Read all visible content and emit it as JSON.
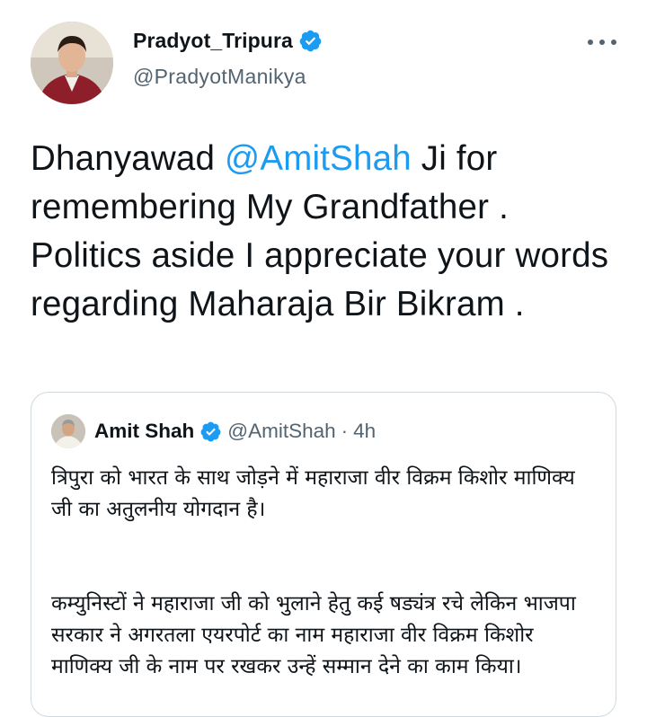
{
  "author": {
    "name": "Pradyot_Tripura",
    "handle": "@PradyotManikya",
    "verified": true
  },
  "tweet": {
    "text_part1": "Dhanyawad ",
    "mention": "@AmitShah",
    "text_part2": " Ji for remembering My Grandfather . Politics aside I appreciate your words regarding Maharaja Bir Bikram ."
  },
  "quoted_tweet": {
    "name": "Amit Shah",
    "handle": "@AmitShah",
    "separator": "·",
    "time": "4h",
    "verified": true,
    "paragraph1": "त्रिपुरा को भारत के साथ जोड़ने में महाराजा वीर विक्रम किशोर माणिक्य जी का अतुलनीय योगदान है।",
    "paragraph2": "कम्युनिस्टों ने महाराजा जी को भुलाने हेतु कई षड्यंत्र रचे लेकिन भाजपा सरकार ने अगरतला एयरपोर्ट का नाम महाराजा वीर विक्रम किशोर माणिक्य जी के नाम पर रखकर उन्हें सम्मान देने का काम किया।"
  },
  "icons": {
    "verified": "verified-badge-icon",
    "more": "more-options-icon"
  },
  "colors": {
    "link": "#1d9bf0",
    "text": "#0f1419",
    "secondary": "#536471",
    "border": "#cfd9de"
  }
}
